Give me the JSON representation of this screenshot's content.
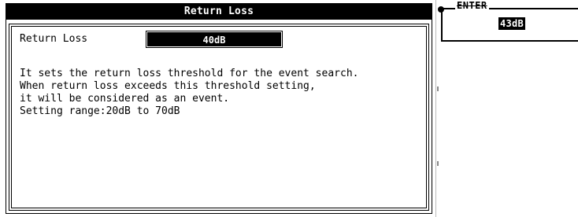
{
  "dialog": {
    "title": "Return Loss",
    "setting_label": "Return Loss",
    "setting_value": "40dB",
    "description_lines": [
      "It sets the return loss threshold for the event search.",
      "When return loss exceeds this threshold setting,",
      "it will be considered as an event.",
      "Setting range:20dB to 70dB"
    ]
  },
  "enter_panel": {
    "label": "ENTER",
    "value": "43dB"
  }
}
